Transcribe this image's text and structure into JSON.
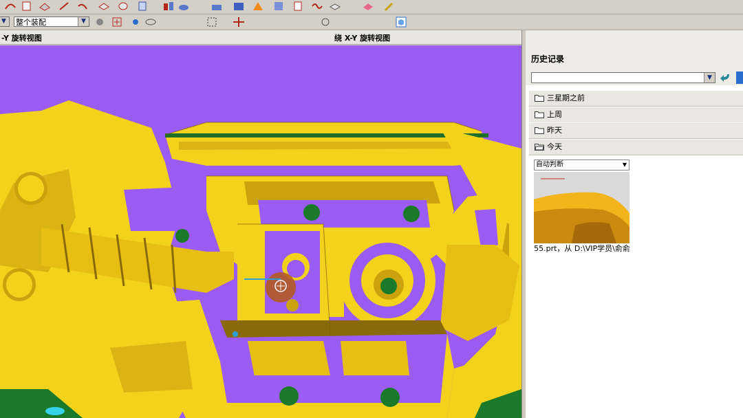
{
  "toolbar": {
    "assembly_select": "整个装配"
  },
  "tabs": {
    "left_label": "-Y 旋转视图",
    "center_label": "绕 X-Y 旋转视图"
  },
  "history_panel": {
    "title": "历史记录",
    "groups": [
      {
        "label": "三星期之前"
      },
      {
        "label": "上周"
      },
      {
        "label": "昨天"
      },
      {
        "label": "今天"
      }
    ],
    "thumbnail": {
      "filter_value": "自动判断",
      "caption": "55.prt，从 D:\\VIP学员\\俞俞"
    }
  },
  "colors": {
    "background": "#9a5cf2",
    "part": "#f2d21b",
    "shadow": "#b38d0c",
    "green": "#1a7a2a"
  }
}
